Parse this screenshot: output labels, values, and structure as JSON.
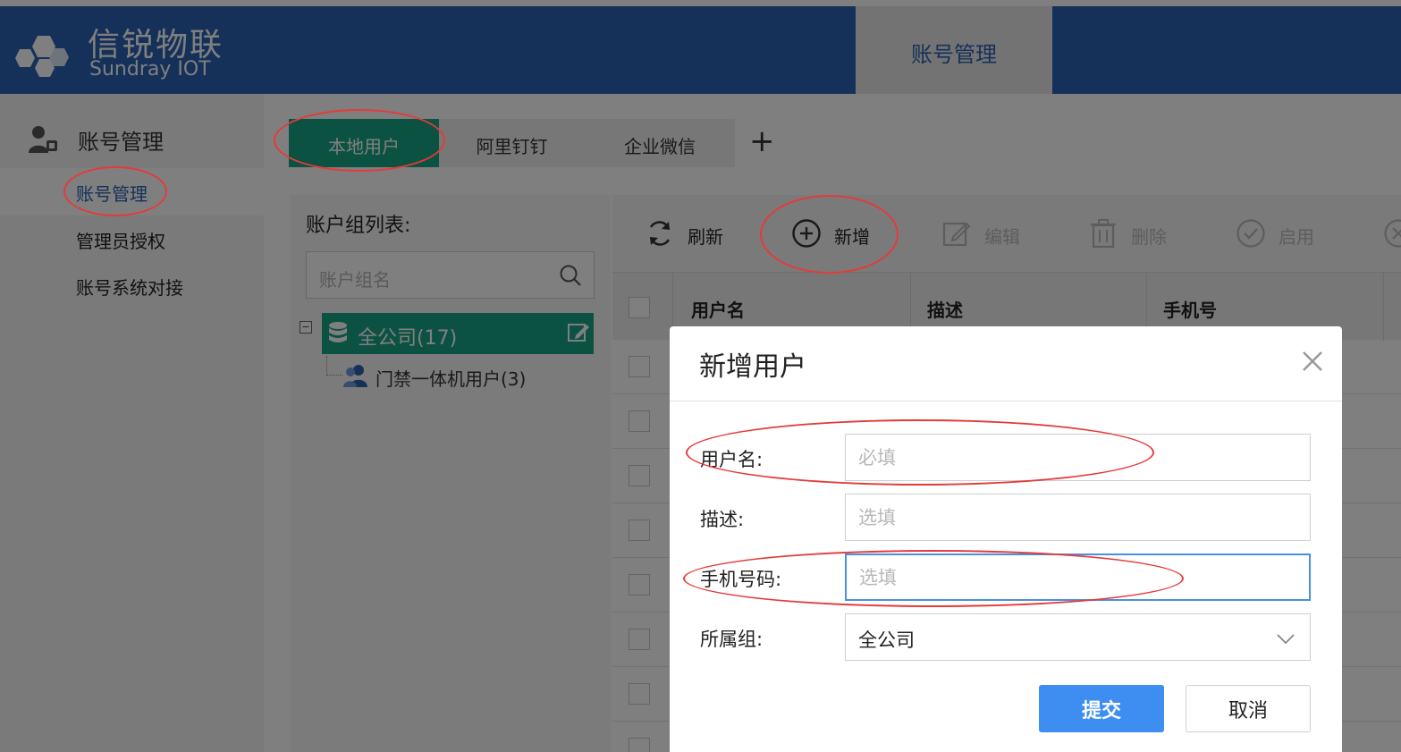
{
  "header": {
    "brand_cn": "信锐物联",
    "brand_en": "Sundray IOT",
    "active_tab": "账号管理"
  },
  "sidebar": {
    "section_title": "账号管理",
    "items": [
      {
        "label": "账号管理",
        "active": true
      },
      {
        "label": "管理员授权",
        "active": false
      },
      {
        "label": "账号系统对接",
        "active": false
      }
    ]
  },
  "tabs": {
    "items": [
      "本地用户",
      "阿里钉钉",
      "企业微信"
    ],
    "active_index": 0,
    "add_label": "+"
  },
  "group_panel": {
    "title": "账户组列表:",
    "search_placeholder": "账户组名",
    "root": "全公司(17)",
    "children": [
      "门禁一体机用户(3)"
    ]
  },
  "toolbar": {
    "refresh": "刷新",
    "add": "新增",
    "edit": "编辑",
    "delete": "删除",
    "enable": "启用"
  },
  "table": {
    "columns": [
      "用户名",
      "描述",
      "手机号"
    ]
  },
  "modal": {
    "title": "新增用户",
    "username_label": "用户名:",
    "username_placeholder": "必填",
    "desc_label": "描述:",
    "desc_placeholder": "选填",
    "phone_label": "手机号码:",
    "phone_placeholder": "选填",
    "group_label": "所属组:",
    "group_value": "全公司",
    "submit": "提交",
    "cancel": "取消"
  },
  "colors": {
    "brand_blue": "#2a63b4",
    "accent_green": "#18a584",
    "submit_blue": "#3d8ef0",
    "annotation_red": "#e53a3a"
  }
}
